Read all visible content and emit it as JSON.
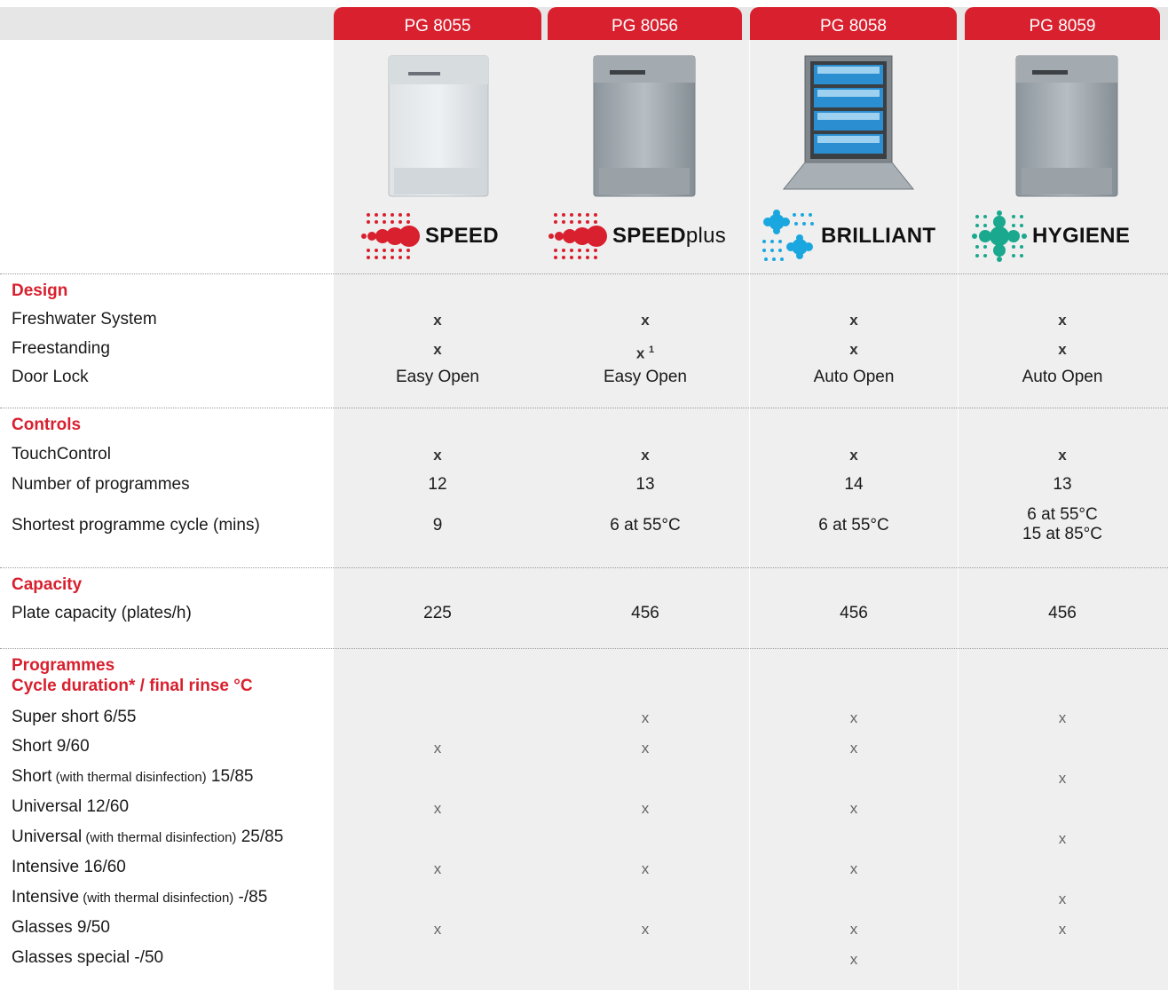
{
  "models": [
    {
      "name": "PG 8055",
      "logo": "SPEED",
      "logo_suffix": "",
      "logo_color": "#d8202e",
      "illustration": "dishwasher-closed"
    },
    {
      "name": "PG 8056",
      "logo": "SPEED",
      "logo_suffix": "plus",
      "logo_color": "#d8202e",
      "illustration": "dishwasher-closed"
    },
    {
      "name": "PG 8058",
      "logo": "BRILLIANT",
      "logo_suffix": "",
      "logo_color": "#1aa7e0",
      "illustration": "dishwasher-open"
    },
    {
      "name": "PG 8059",
      "logo": "HYGIENE",
      "logo_suffix": "",
      "logo_color": "#1aa88e",
      "illustration": "dishwasher-closed"
    }
  ],
  "sections": {
    "design": {
      "title": "Design",
      "rows": [
        {
          "label": "Freshwater System",
          "values": [
            "x",
            "x",
            "x",
            "x"
          ]
        },
        {
          "label": "Freestanding",
          "values": [
            "x",
            "x",
            "x",
            "x"
          ],
          "footnote": [
            "",
            "1",
            "",
            ""
          ]
        },
        {
          "label": "Door Lock",
          "values": [
            "Easy Open",
            "Easy Open",
            "Auto Open",
            "Auto Open"
          ]
        }
      ]
    },
    "controls": {
      "title": "Controls",
      "rows": [
        {
          "label": "TouchControl",
          "values": [
            "x",
            "x",
            "x",
            "x"
          ]
        },
        {
          "label": "Number of programmes",
          "values": [
            "12",
            "13",
            "14",
            "13"
          ]
        },
        {
          "label": "Shortest programme cycle (mins)",
          "values": [
            "9",
            "6 at 55°C",
            "6 at 55°C",
            "6 at 55°C"
          ],
          "second_line": [
            "",
            "",
            "",
            "15 at 85°C"
          ]
        }
      ]
    },
    "capacity": {
      "title": "Capacity",
      "rows": [
        {
          "label": "Plate capacity (plates/h)",
          "values": [
            "225",
            "456",
            "456",
            "456"
          ]
        }
      ]
    },
    "programmes": {
      "title": "Programmes",
      "subtitle": "Cycle duration* / final rinse °C",
      "rows": [
        {
          "label": "Super short 6/55",
          "label_main": "Super short",
          "label_note": "",
          "label_tail": " 6/55",
          "values": [
            "",
            "x",
            "x",
            "x"
          ]
        },
        {
          "label": "Short 9/60",
          "label_main": "Short",
          "label_note": "",
          "label_tail": " 9/60",
          "values": [
            "x",
            "x",
            "x",
            ""
          ]
        },
        {
          "label": "Short (with thermal disinfection) 15/85",
          "label_main": "Short",
          "label_note": " (with thermal disinfection)",
          "label_tail": " 15/85",
          "values": [
            "",
            "",
            "",
            "x"
          ]
        },
        {
          "label": "Universal 12/60",
          "label_main": "Universal",
          "label_note": "",
          "label_tail": " 12/60",
          "values": [
            "x",
            "x",
            "x",
            ""
          ]
        },
        {
          "label": "Universal (with thermal disinfection) 25/85",
          "label_main": "Universal",
          "label_note": " (with thermal disinfection)",
          "label_tail": " 25/85",
          "values": [
            "",
            "",
            "",
            "x"
          ]
        },
        {
          "label": "Intensive 16/60",
          "label_main": "Intensive",
          "label_note": "",
          "label_tail": " 16/60",
          "values": [
            "x",
            "x",
            "x",
            ""
          ]
        },
        {
          "label": "Intensive (with thermal disinfection) -/85",
          "label_main": "Intensive",
          "label_note": " (with thermal disinfection)",
          "label_tail": " -/85",
          "values": [
            "",
            "",
            "",
            "x"
          ]
        },
        {
          "label": "Glasses 9/50",
          "label_main": "Glasses",
          "label_note": "",
          "label_tail": " 9/50",
          "values": [
            "x",
            "x",
            "x",
            "x"
          ]
        },
        {
          "label": "Glasses special -/50",
          "label_main": "Glasses special",
          "label_note": "",
          "label_tail": " -/50",
          "values": [
            "",
            "",
            "x",
            ""
          ]
        }
      ]
    }
  }
}
